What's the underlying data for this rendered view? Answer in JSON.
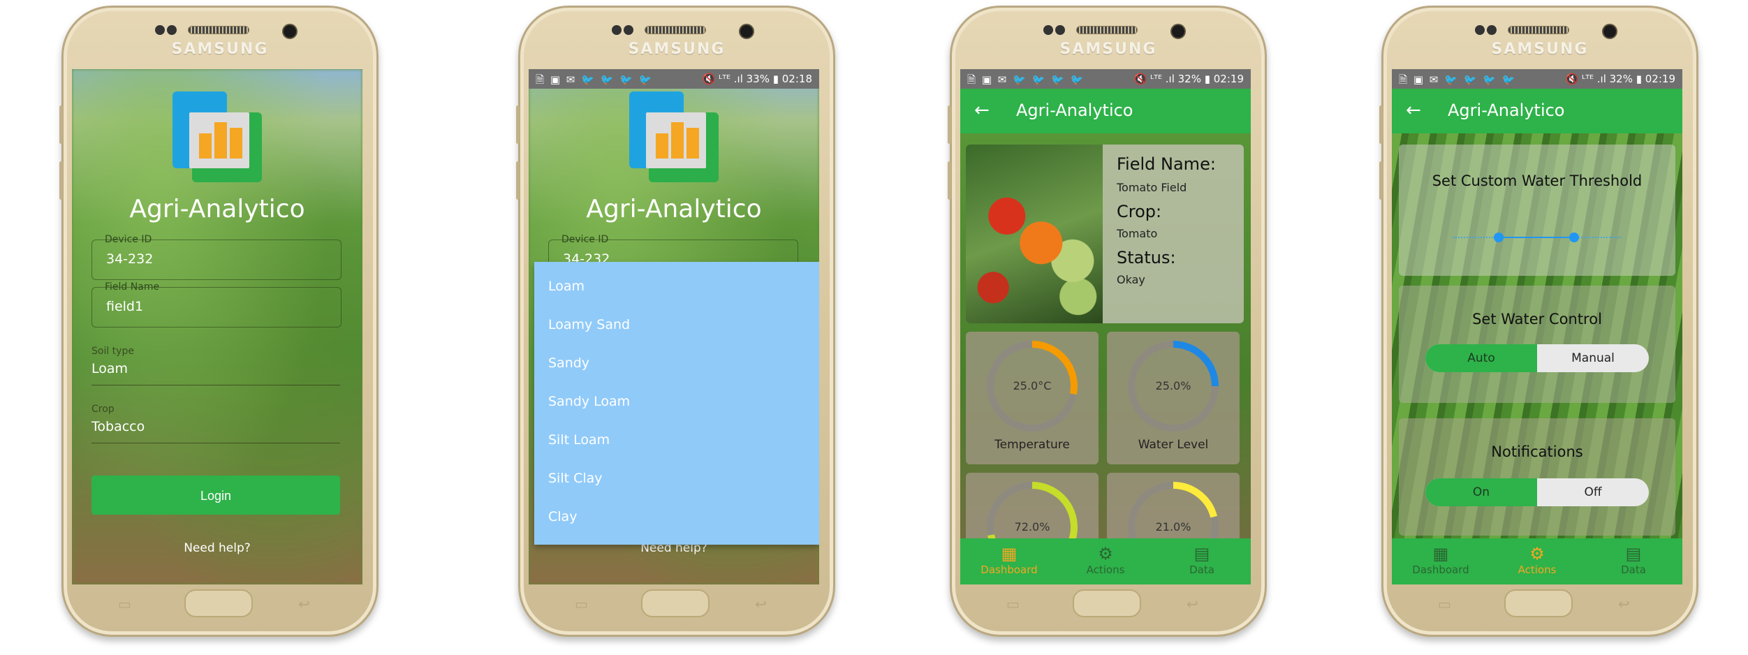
{
  "device_brand": "SAMSUNG",
  "app_title": "Agri-Analytico",
  "status": {
    "left_icons": "🗎 ▣ ✉ 🐦 🐦 🐦 🐦",
    "screen2_right": "🔇 ᴸᵀᴱ .ıl 33% ▮ 02:18",
    "screen3_right": "🔇 ᴸᵀᴱ .ıl 32% ▮ 02:19",
    "screen4_right": "🔇 ᴸᵀᴱ .ıl 32% ▮ 02:19"
  },
  "login": {
    "device_id_label": "Device ID",
    "device_id_value": "34-232",
    "field_name_label": "Field Name",
    "field_name_value": "field1",
    "soil_type_label": "Soil type",
    "soil_type_value": "Loam",
    "crop_label": "Crop",
    "crop_value": "Tobacco",
    "login_button": "Login",
    "help_link": "Need help?"
  },
  "soil_dropdown": {
    "partial_device_id_label": "Device ID",
    "partial_device_id_value": "34-232",
    "options": [
      "Loam",
      "Loamy Sand",
      "Sandy",
      "Sandy Loam",
      "Silt Loam",
      "Silt Clay",
      "Clay"
    ],
    "help_link": "Need help?"
  },
  "dashboard": {
    "field_name_label": "Field Name:",
    "field_name_value": "Tomato Field",
    "crop_label": "Crop:",
    "crop_value": "Tomato",
    "status_label": "Status:",
    "status_value": "Okay",
    "gauges": [
      {
        "value": "25.0°C",
        "label": "Temperature",
        "color": "#f59b00",
        "fraction": 0.28
      },
      {
        "value": "25.0%",
        "label": "Water Level",
        "color": "#1e88e5",
        "fraction": 0.25
      },
      {
        "value": "72.0%",
        "label": "",
        "color": "#c6dd2a",
        "fraction": 0.72
      },
      {
        "value": "21.0%",
        "label": "",
        "color": "#ffeb3b",
        "fraction": 0.21
      }
    ]
  },
  "actions": {
    "threshold_title": "Set Custom Water Threshold",
    "water_control_title": "Set Water Control",
    "water_auto": "Auto",
    "water_manual": "Manual",
    "notifications_title": "Notifications",
    "notif_on": "On",
    "notif_off": "Off",
    "threshold_range_fraction": [
      0.27,
      0.72
    ]
  },
  "nav": {
    "dashboard": "Dashboard",
    "actions": "Actions",
    "data": "Data",
    "dashboard_icon": "dashboard-icon",
    "actions_icon": "gear-icon",
    "data_icon": "library-icon"
  },
  "colors": {
    "primary_green": "#2eb24a",
    "accent_orange": "#f5a623",
    "dropdown_blue": "#90caf9"
  }
}
